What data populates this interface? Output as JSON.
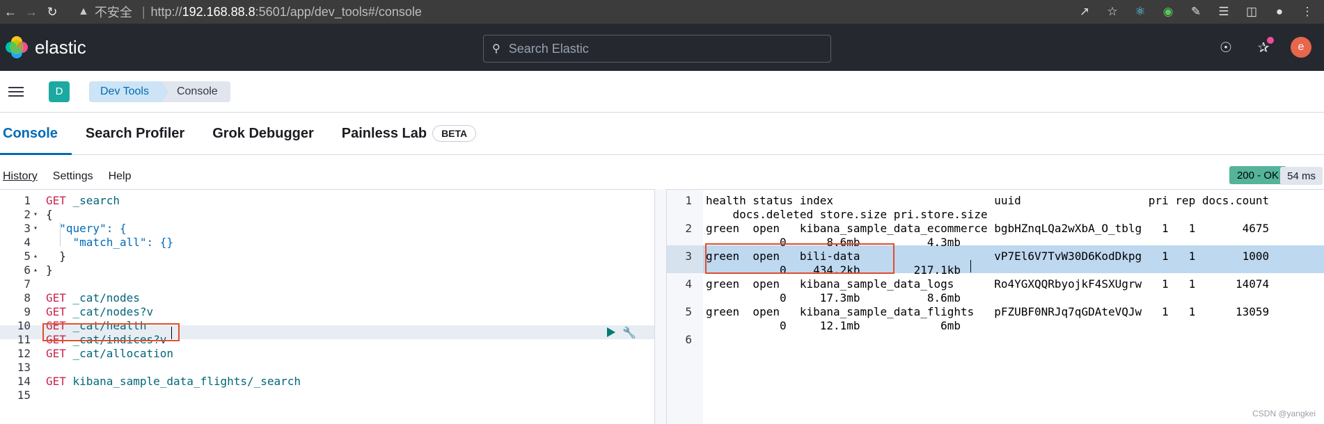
{
  "browser": {
    "insecure_label": "不安全",
    "url_scheme": "http://",
    "url_host": "192.168.88.8",
    "url_rest": ":5601/app/dev_tools#/console"
  },
  "header": {
    "logo_text": "elastic",
    "search_placeholder": "Search Elastic",
    "avatar_letter": "e"
  },
  "breadcrumb": {
    "space_letter": "D",
    "items": [
      "Dev Tools",
      "Console"
    ]
  },
  "tabs": {
    "items": [
      "Console",
      "Search Profiler",
      "Grok Debugger",
      "Painless Lab"
    ],
    "beta_label": "BETA"
  },
  "toolbar": {
    "history": "History",
    "settings": "Settings",
    "help": "Help",
    "status": "200 - OK",
    "timing": "54 ms"
  },
  "request_editor": {
    "line_numbers": [
      "1",
      "2",
      "3",
      "4",
      "5",
      "6",
      "7",
      "8",
      "9",
      "10",
      "11",
      "12",
      "13",
      "14",
      "15"
    ],
    "lines": [
      {
        "method": "GET",
        "path": " _search"
      },
      {
        "text": "{"
      },
      {
        "text": "  \"query\": {"
      },
      {
        "text": "    \"match_all\": {}"
      },
      {
        "text": "  }"
      },
      {
        "text": "}"
      },
      {
        "text": ""
      },
      {
        "method": "GET",
        "path": " _cat/nodes"
      },
      {
        "method": "GET",
        "path": " _cat/nodes?v"
      },
      {
        "method": "GET",
        "path": " _cat/health"
      },
      {
        "method": "GET",
        "path": " _cat/indices?v"
      },
      {
        "method": "GET",
        "path": " _cat/allocation"
      },
      {
        "text": ""
      },
      {
        "method": "GET",
        "path": " kibana_sample_data_flights/_search"
      },
      {
        "text": ""
      }
    ]
  },
  "response_editor": {
    "rows": [
      {
        "num": "1",
        "lines": [
          "health status index                        uuid                   pri rep docs.count",
          "    docs.deleted store.size pri.store.size"
        ]
      },
      {
        "num": "2",
        "lines": [
          "green  open   kibana_sample_data_ecommerce bgbHZnqLQa2wXbA_O_tblg   1   1       4675",
          "           0      8.6mb          4.3mb"
        ]
      },
      {
        "num": "3",
        "lines": [
          "green  open   bili-data                    vP7El6V7TvW30D6KodDkpg   1   1       1000",
          "           0    434.2kb        217.1kb"
        ]
      },
      {
        "num": "4",
        "lines": [
          "green  open   kibana_sample_data_logs      Ro4YGXQQRbyojkF4SXUgrw   1   1      14074",
          "           0     17.3mb          8.6mb"
        ]
      },
      {
        "num": "5",
        "lines": [
          "green  open   kibana_sample_data_flights   pFZUBF0NRJq7qGDAteVQJw   1   1      13059",
          "           0     12.1mb            6mb"
        ]
      },
      {
        "num": "6",
        "lines": [
          ""
        ]
      }
    ]
  },
  "watermark": "CSDN @yangkei",
  "colors": {
    "accent": "#006bb8",
    "status_ok": "#54b399",
    "highlight_box": "#e04d2a"
  }
}
